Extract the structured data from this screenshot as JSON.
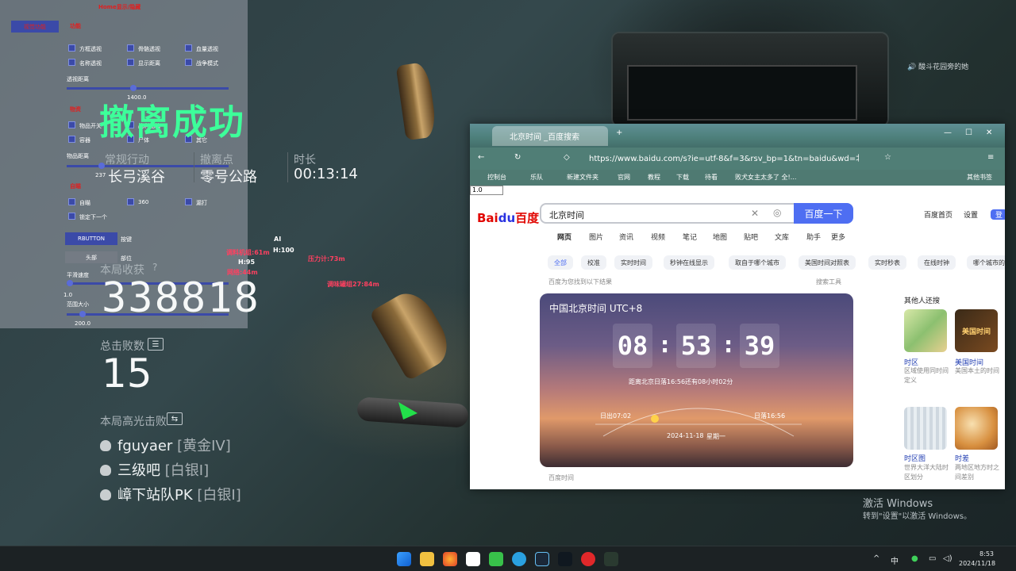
{
  "cheat_panel": {
    "title": "Home显示/隐藏",
    "tab_active": "视觉功能",
    "section_red_1": "功能",
    "checks_row1": [
      "方框透视",
      "骨骼透视",
      "血量透视"
    ],
    "checks_row2": [
      "名称透视",
      "显示距离",
      "战争模式"
    ],
    "slider_label_1": "透视距离",
    "slider_value_1": "1400.0",
    "section_red_2": "物资",
    "items_row1": [
      "物品开关",
      "战利品箱"
    ],
    "items_row2": [
      "容器",
      "尸体",
      "其它"
    ],
    "slider_label_2": "物品距离",
    "slider_value_2": "237",
    "section_red_3": "自瞄",
    "aim_row": [
      "自瞄",
      "360",
      "漏打"
    ],
    "lock_next": "锁定下一个",
    "key_button": "RBUTTON",
    "key_label": "按键",
    "part_button": "头部",
    "part_label": "部位",
    "smooth_label": "平滑速度",
    "smooth_value": "1.0",
    "range_label": "范围大小",
    "range_value": "200.0"
  },
  "game": {
    "result_title": "撤离成功",
    "mode_label": "常规行动",
    "mode_value": "长弓溪谷",
    "extract_label": "撤离点",
    "extract_value": "零号公路",
    "time_label": "时长",
    "time_value": "00:13:14",
    "earnings_label": "本局收获",
    "earnings_help": "?",
    "earnings_value": "338818",
    "kills_label": "总击败数",
    "kills_value": "15",
    "highlights_label": "本局高光击败",
    "players": [
      {
        "name": "fguyaer",
        "rank": "[黄金IV]"
      },
      {
        "name": "三级吧",
        "rank": "[白银I]"
      },
      {
        "name": "嶂下站队PK",
        "rank": "[白银I]"
      }
    ]
  },
  "esp": {
    "label_ai": "AI",
    "t1": "调料机组:61m",
    "t2": "H:95",
    "t3": "网络:44m",
    "t4": "H:100",
    "t5": "压力计:73m",
    "t6": "调味罐组27:84m"
  },
  "music_widget": "酸斗花园旁的她",
  "browser": {
    "tab_title": "北京时间 _百度搜索",
    "url": "https://www.baidu.com/s?ie=utf-8&f=3&rsv_bp=1&tn=baidu&wd=北京时间",
    "bookmarks": [
      "控制台",
      "乐队",
      "新建文件夹",
      "官网",
      "教程",
      "下载",
      "待看",
      "败犬女主太多了 全!...",
      "其他书签"
    ],
    "zoom": "1.0",
    "search_text": "北京时间",
    "search_button": "百度一下",
    "top_links": [
      "百度首页",
      "设置",
      "登"
    ],
    "nav": [
      "网页",
      "图片",
      "资讯",
      "视频",
      "笔记",
      "地图",
      "贴吧",
      "文库",
      "助手",
      "更多"
    ],
    "pills": [
      "全部",
      "校准",
      "实时时间",
      "秒钟在线显示",
      "取自于哪个城市",
      "美国时间对照表",
      "实时秒表",
      "在线时钟",
      "哪个城市的"
    ],
    "result_hint": "百度为您找到以下结果",
    "tools": "搜索工具",
    "card_title": "中国北京时间 UTC+8",
    "hours": "08",
    "minutes": "53",
    "seconds": "39",
    "sunset_note": "距离北京日落16:56还有08小时02分",
    "sunrise": "日出07:02",
    "sunset": "日落16:56",
    "date": "2024-11-18",
    "weekday": "星期一",
    "footer": "百度时间",
    "side_heading": "其他人还搜",
    "side_items": [
      {
        "name": "时区",
        "desc": "区域使用同时间定义"
      },
      {
        "name": "美国时间",
        "desc": "美国本土的时间"
      },
      {
        "name": "时区图",
        "desc": "世界大洋大陆时区划分"
      },
      {
        "name": "时差",
        "desc": "两地区地方时之间差别"
      }
    ],
    "thumb_label": "美国时间"
  },
  "activation": {
    "line1": "激活 Windows",
    "line2": "转到\"设置\"以激活 Windows。"
  },
  "taskbar": {
    "ime": "中",
    "time": "8:53",
    "date": "2024/11/18"
  }
}
